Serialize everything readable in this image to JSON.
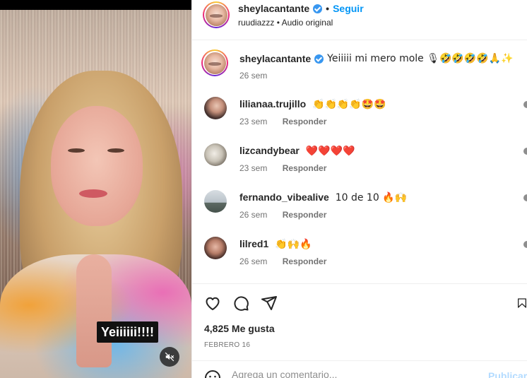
{
  "video": {
    "caption": "Yeiiiiii!!!!",
    "mute_icon": "speaker-muted-icon"
  },
  "header": {
    "username": "sheylacantante",
    "separator": "•",
    "follow_label": "Seguir",
    "subtitle": "ruudiazzz • Audio original"
  },
  "post_caption": {
    "username": "sheylacantante",
    "text": "Yeiiiii mi mero mole 🎙🤣🤣🤣🤣🙏✨",
    "time": "26 sem"
  },
  "comments": [
    {
      "username": "lilianaa.trujillo",
      "text": "👏👏👏👏🤩🤩",
      "time": "23 sem",
      "reply_label": "Responder"
    },
    {
      "username": "lizcandybear",
      "text": "❤️❤️❤️❤️",
      "time": "23 sem",
      "reply_label": "Responder"
    },
    {
      "username": "fernando_vibealive",
      "text": "10 de 10 🔥🙌",
      "time": "26 sem",
      "reply_label": "Responder"
    },
    {
      "username": "lilred1",
      "text": "👏🙌🔥",
      "time": "26 sem",
      "reply_label": "Responder"
    }
  ],
  "actions": {
    "like_icon": "heart-icon",
    "comment_icon": "comment-icon",
    "share_icon": "paper-plane-icon",
    "save_icon": "bookmark-icon"
  },
  "likes": "4,825 Me gusta",
  "date": "FEBRERO 16",
  "composer": {
    "placeholder": "Agrega un comentario...",
    "post_label": "Publicar"
  },
  "colors": {
    "accent": "#0095f6",
    "verified": "#3897f0",
    "muted_text": "#737373"
  }
}
